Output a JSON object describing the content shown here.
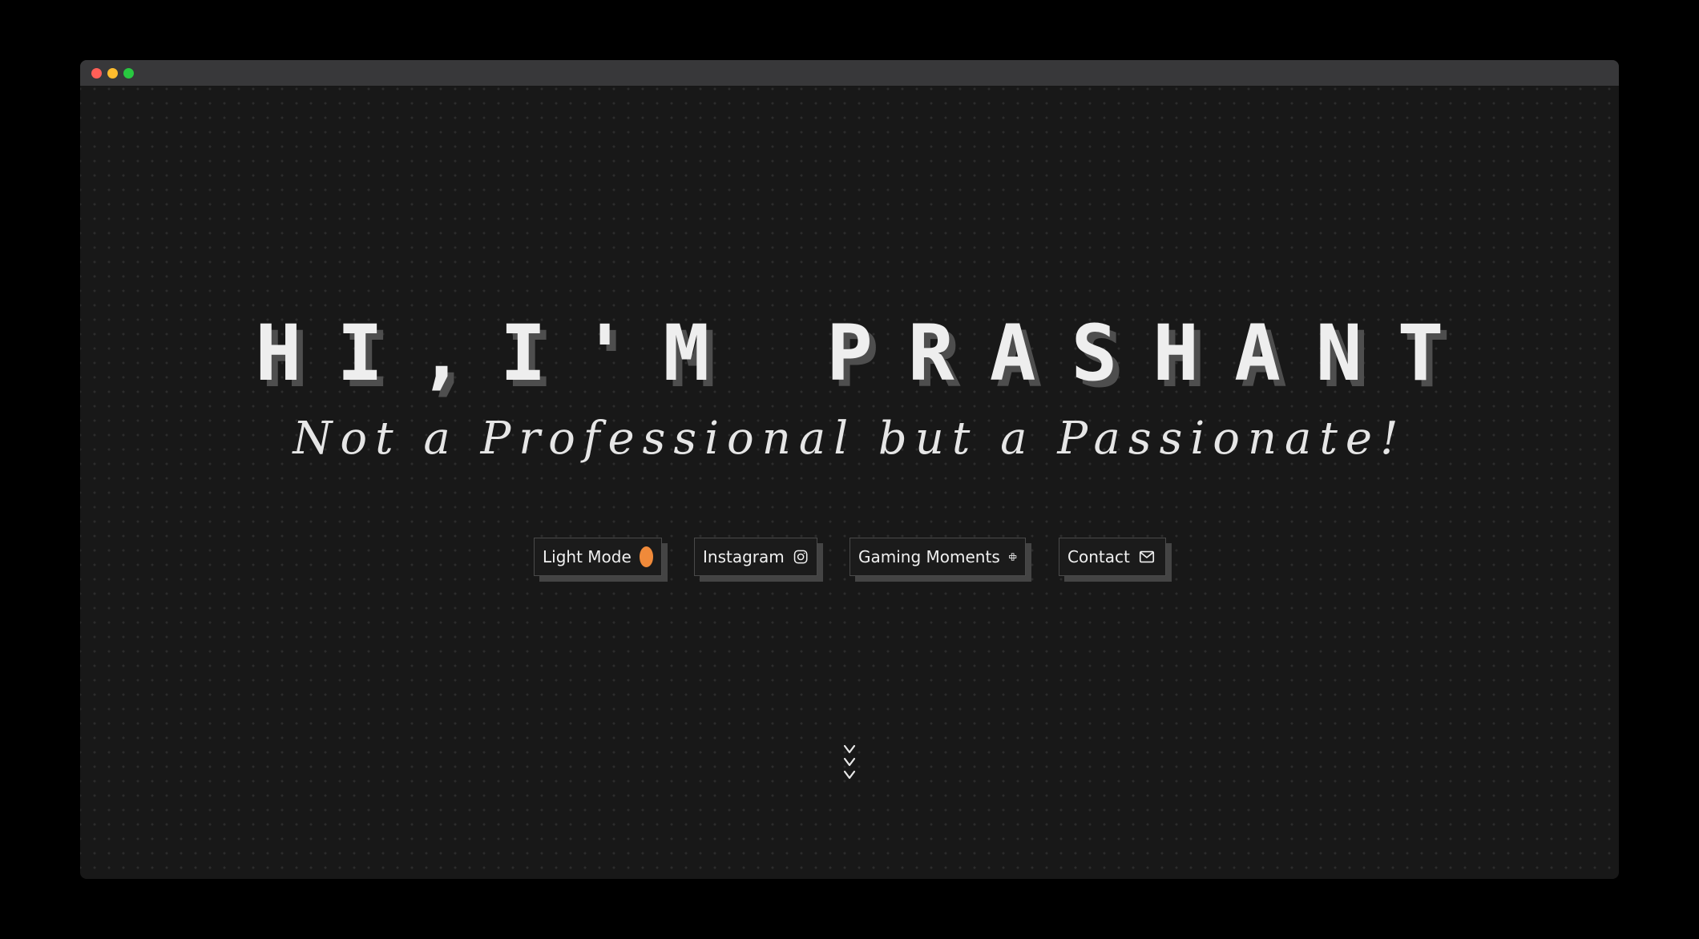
{
  "hero": {
    "title": "HI,I'M PRASHANT",
    "subtitle": "Not a Professional but a Passionate!"
  },
  "buttons": {
    "light_mode": {
      "label": "Light Mode",
      "icon": "sun-icon"
    },
    "instagram": {
      "label": "Instagram",
      "icon": "instagram-icon"
    },
    "gaming": {
      "label": "Gaming Moments",
      "icon": "gamepad-icon"
    },
    "contact": {
      "label": "Contact",
      "icon": "mail-icon"
    }
  },
  "scroll": {
    "icon": "chevrons-down-icon"
  },
  "colors": {
    "page_bg": "#181818",
    "accent": "#f08a3a",
    "text": "#eeeeee",
    "shadow": "#4e4e4e"
  }
}
